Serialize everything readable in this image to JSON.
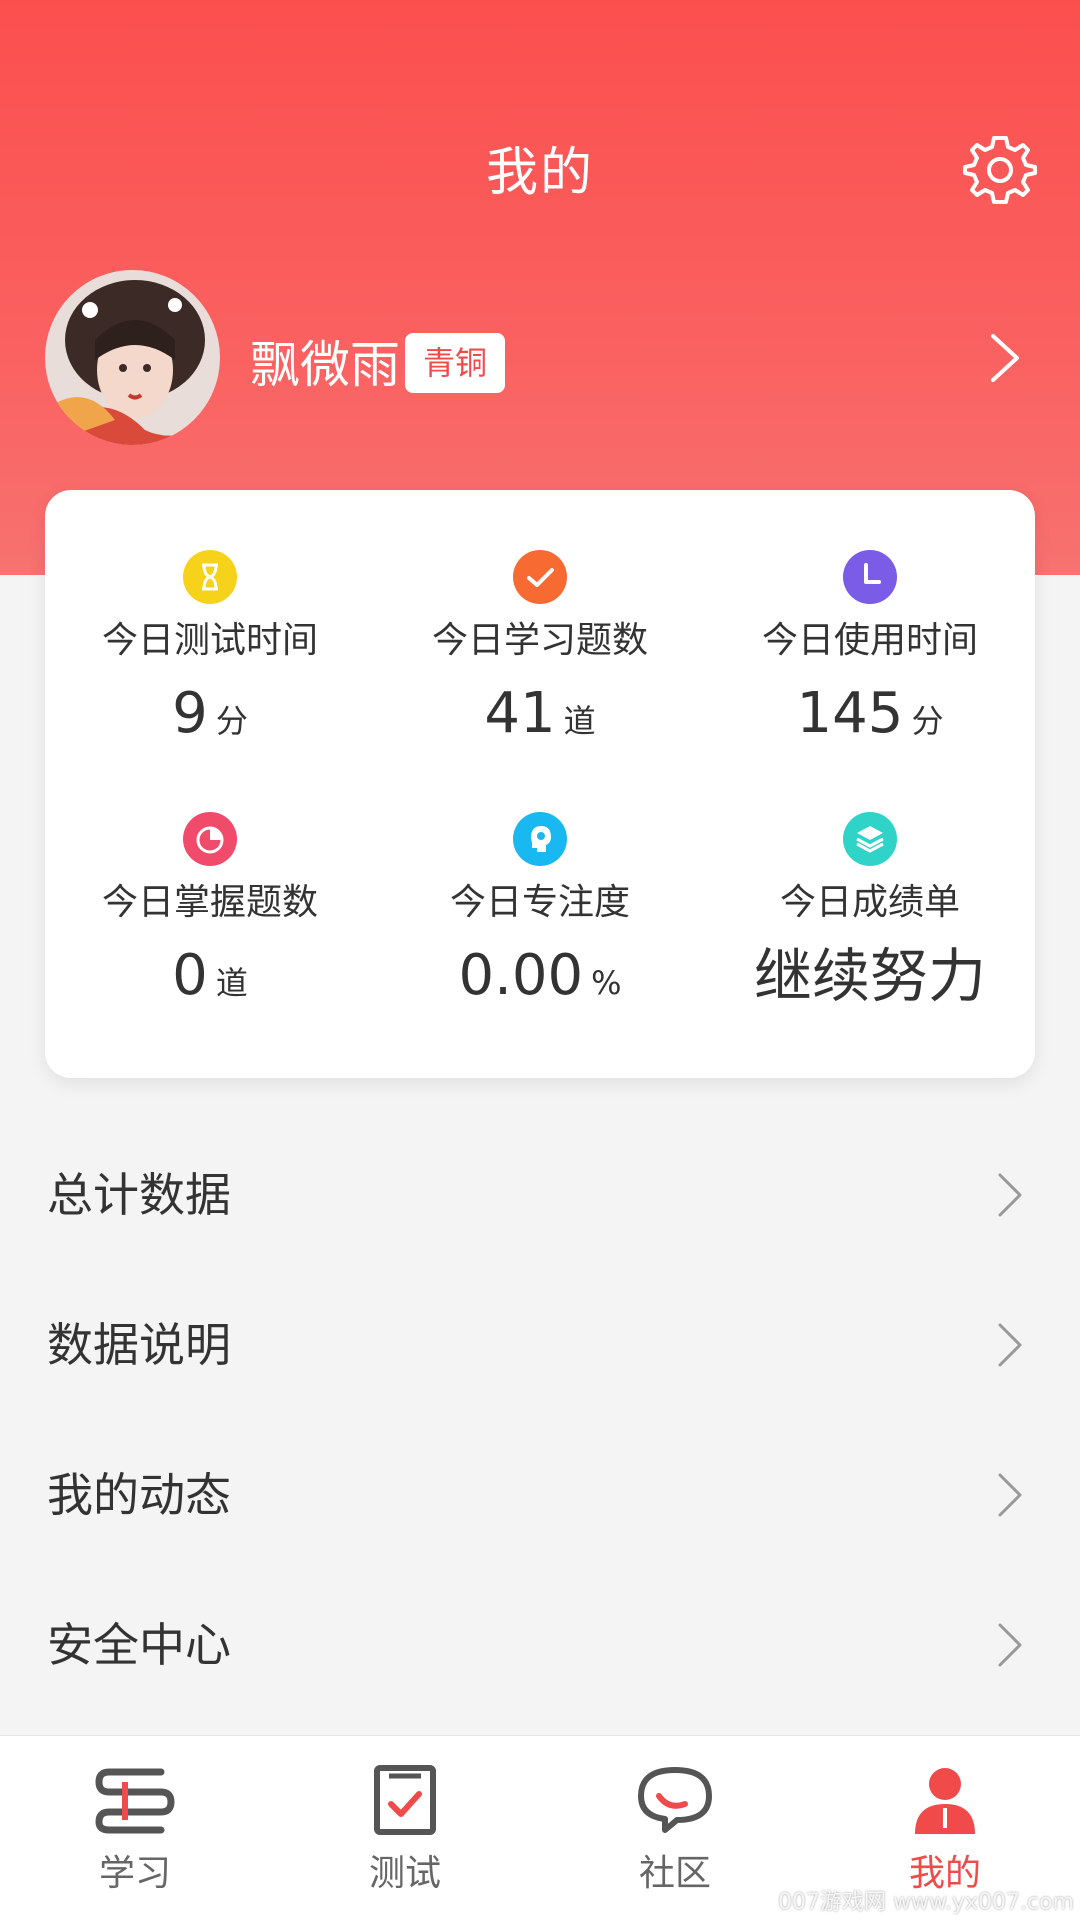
{
  "header": {
    "title": "我的",
    "settings_icon": "gear-icon"
  },
  "profile": {
    "name": "飘微雨",
    "level": "青铜",
    "chevron_icon": "chevron-right-icon"
  },
  "stats": [
    {
      "label": "今日测试时间",
      "value": "9",
      "unit": "分",
      "icon": "hourglass-icon",
      "color": "#f7d21b"
    },
    {
      "label": "今日学习题数",
      "value": "41",
      "unit": "道",
      "icon": "check-icon",
      "color": "#f76b33"
    },
    {
      "label": "今日使用时间",
      "value": "145",
      "unit": "分",
      "icon": "clock-icon",
      "color": "#7b5ce6"
    },
    {
      "label": "今日掌握题数",
      "value": "0",
      "unit": "道",
      "icon": "pie-icon",
      "color": "#f04b6a"
    },
    {
      "label": "今日专注度",
      "value": "0.00",
      "unit": "%",
      "icon": "focus-icon",
      "color": "#1ab8f0"
    },
    {
      "label": "今日成绩单",
      "value": "继续努力",
      "unit": "",
      "icon": "layers-icon",
      "color": "#2fd3c8"
    }
  ],
  "menu": [
    {
      "label": "总计数据"
    },
    {
      "label": "数据说明"
    },
    {
      "label": "我的动态"
    },
    {
      "label": "安全中心"
    }
  ],
  "nav": [
    {
      "label": "学习",
      "icon": "study-icon",
      "active": false
    },
    {
      "label": "测试",
      "icon": "test-icon",
      "active": false
    },
    {
      "label": "社区",
      "icon": "chat-icon",
      "active": false
    },
    {
      "label": "我的",
      "icon": "user-icon",
      "active": true
    }
  ],
  "watermark": "007游戏网 www.yx007.com",
  "colors": {
    "accent": "#f04b4a",
    "header_top": "#fb4f4e",
    "text": "#333333",
    "background": "#f4f4f4"
  }
}
